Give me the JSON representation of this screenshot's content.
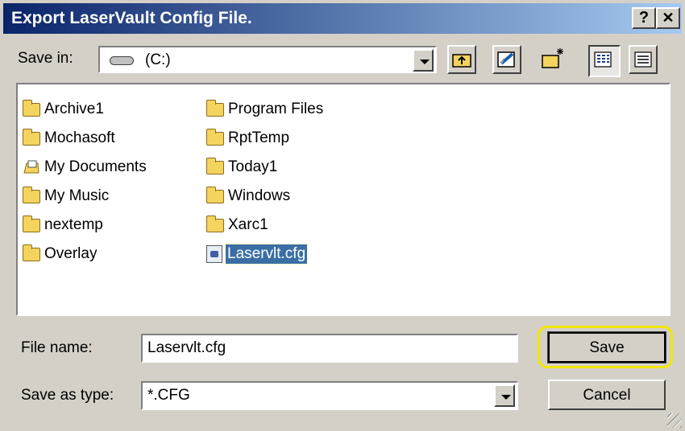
{
  "dialog": {
    "title": "Export LaserVault Config File.",
    "help_label": "?",
    "close_label": "✕"
  },
  "save_in": {
    "label": "Save in:",
    "label_accel": "i",
    "value": "(C:)"
  },
  "toolbar": [
    "up-one-level",
    "desktop",
    "create-new-folder",
    "list-view",
    "details-view"
  ],
  "files": {
    "col1": [
      "Archive1",
      "Mochasoft",
      "My Documents",
      "My Music",
      "nextemp",
      "Overlay"
    ],
    "col2": [
      "Program Files",
      "RptTemp",
      "Today1",
      "Windows",
      "Xarc1",
      "Laservlt.cfg"
    ],
    "selected": "Laservlt.cfg"
  },
  "file_name": {
    "label": "File name:",
    "value": "Laservlt.cfg"
  },
  "save_as_type": {
    "label": "Save as type:",
    "value": "*.CFG"
  },
  "buttons": {
    "save": "Save",
    "cancel": "Cancel"
  },
  "colors": {
    "title_bar": "#0a246a",
    "selection": "#3a6ea5",
    "highlight_outline": "#f2e600"
  }
}
